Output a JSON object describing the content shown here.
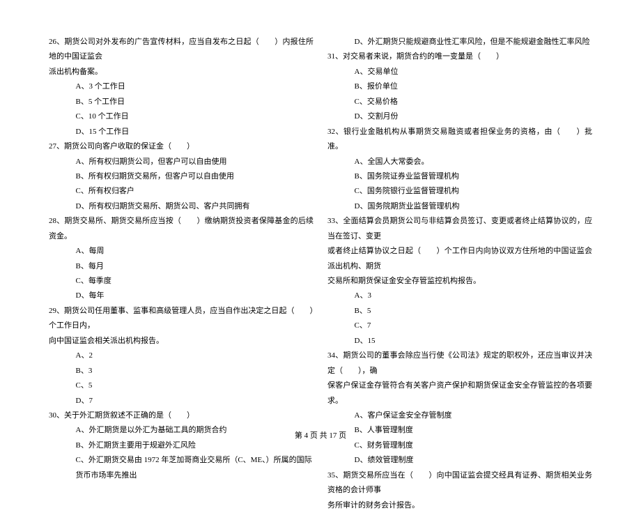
{
  "left": {
    "q26": {
      "text1": "26、期货公司对外发布的广告宣传材料，应当自发布之日起（　　）内报住所地的中国证监会",
      "text2": "派出机构备案。",
      "opts": [
        "A、3 个工作日",
        "B、5 个工作日",
        "C、10 个工作日",
        "D、15 个工作日"
      ]
    },
    "q27": {
      "text1": "27、期货公司向客户收取的保证金（　　）",
      "opts": [
        "A、所有权归期货公司，但客户可以自由使用",
        "B、所有权归期货交易所，但客户可以自由使用",
        "C、所有权归客户",
        "D、所有权归期货交易所、期货公司、客户共同拥有"
      ]
    },
    "q28": {
      "text1": "28、期货交易所、期货交易所应当按（　　）缴纳期货投资者保障基金的后续资金。",
      "opts": [
        "A、每周",
        "B、每月",
        "C、每季度",
        "D、每年"
      ]
    },
    "q29": {
      "text1": "29、期货公司任用董事、监事和高级管理人员，应当自作出决定之日起（　　）个工作日内，",
      "text2": "向中国证监会相关派出机构报告。",
      "opts": [
        "A、2",
        "B、3",
        "C、5",
        "D、7"
      ]
    },
    "q30": {
      "text1": "30、关于外汇期货叙述不正确的是（　　）",
      "opts": [
        "A、外汇期货是以外汇为基础工具的期货合约",
        "B、外汇期货主要用于规避外汇风险",
        "C、外汇期货交易由 1972 年芝加哥商业交易所（C、ME、）所属的国际货币市场率先推出"
      ]
    }
  },
  "right": {
    "q30_optD": "D、外汇期货只能规避商业性汇率风险，但是不能规避金融性汇率风险",
    "q31": {
      "text1": "31、对交易者来说，期货合约的唯一变量是（　　）",
      "opts": [
        "A、交易单位",
        "B、报价单位",
        "C、交易价格",
        "D、交割月份"
      ]
    },
    "q32": {
      "text1": "32、银行业金融机构从事期货交易融资或者担保业务的资格，由（　　）批准。",
      "opts": [
        "A、全国人大常委会。",
        "B、国务院证券业监督管理机构",
        "C、国务院银行业监督管理机构",
        "D、国务院期货业监督管理机构"
      ]
    },
    "q33": {
      "text1": "33、全面结算会员期货公司与非结算会员签订、变更或者终止结算协议的，应当在签订、变更",
      "text2": "或者终止结算协议之日起（　　）个工作日内向协议双方住所地的中国证监会派出机构、期货",
      "text3": "交易所和期货保证金安全存管监控机构报告。",
      "opts": [
        "A、3",
        "B、5",
        "C、7",
        "D、15"
      ]
    },
    "q34": {
      "text1": "34、期货公司的董事会除应当行使《公司法》规定的职权外，还应当审议并决定（　　），确",
      "text2": "保客户保证金存管符合有关客户资产保护和期货保证金安全存管监控的各项要求。",
      "opts": [
        "A、客户保证金安全存管制度",
        "B、人事管理制度",
        "C、财务管理制度",
        "D、绩效管理制度"
      ]
    },
    "q35": {
      "text1": "35、期货交易所应当在（　　）向中国证监会提交经具有证券、期货相关业务资格的会计师事",
      "text2": "务所审计的财务会计报告。"
    }
  },
  "footer": "第 4 页 共 17 页"
}
